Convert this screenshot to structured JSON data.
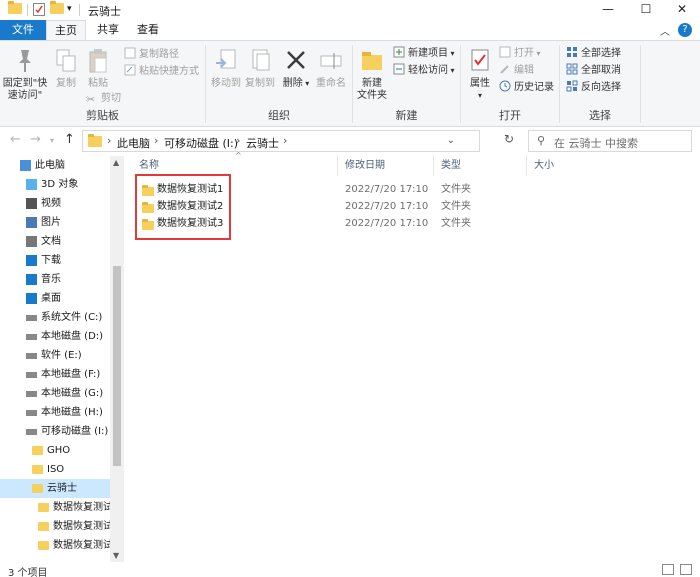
{
  "window": {
    "title": "云骑士",
    "controls": {
      "minimize": "—",
      "maximize": "☐",
      "close": "✕"
    }
  },
  "tabs": [
    {
      "label": "文件"
    },
    {
      "label": "主页"
    },
    {
      "label": "共享"
    },
    {
      "label": "查看"
    }
  ],
  "ribbon": {
    "clipboard": {
      "label": "剪贴板",
      "pin": "固定到\"快\n速访问\"",
      "copy": "复制",
      "paste": "粘贴",
      "copy_path": "复制路径",
      "paste_shortcut": "粘贴快捷方式",
      "cut": "剪切"
    },
    "organize": {
      "label": "组织",
      "move_to": "移动到",
      "copy_to": "复制到",
      "delete": "删除",
      "rename": "重命名"
    },
    "new": {
      "label": "新建",
      "new_folder": "新建\n文件夹",
      "new_item": "新建项目",
      "easy_access": "轻松访问"
    },
    "open": {
      "label": "打开",
      "properties": "属性",
      "open": "打开",
      "edit": "编辑",
      "history": "历史记录"
    },
    "select": {
      "label": "选择",
      "select_all": "全部选择",
      "select_none": "全部取消",
      "invert": "反向选择"
    }
  },
  "address": {
    "crumbs": [
      "此电脑",
      "可移动磁盘 (I:)",
      "云骑士"
    ],
    "search_placeholder": "在 云骑士 中搜索"
  },
  "nav": {
    "items": [
      {
        "label": "此电脑",
        "icon": "computer-icon",
        "indent": 0
      },
      {
        "label": "3D 对象",
        "icon": "3d-objects-icon",
        "indent": 1
      },
      {
        "label": "视频",
        "icon": "video-icon",
        "indent": 1
      },
      {
        "label": "图片",
        "icon": "pictures-icon",
        "indent": 1
      },
      {
        "label": "文档",
        "icon": "documents-icon",
        "indent": 1
      },
      {
        "label": "下载",
        "icon": "download-icon",
        "indent": 1
      },
      {
        "label": "音乐",
        "icon": "music-icon",
        "indent": 1
      },
      {
        "label": "桌面",
        "icon": "desktop-icon",
        "indent": 1
      },
      {
        "label": "系统文件 (C:)",
        "icon": "drive-icon",
        "indent": 1
      },
      {
        "label": "本地磁盘 (D:)",
        "icon": "drive-icon",
        "indent": 1
      },
      {
        "label": "软件 (E:)",
        "icon": "drive-icon",
        "indent": 1
      },
      {
        "label": "本地磁盘 (F:)",
        "icon": "drive-icon",
        "indent": 1
      },
      {
        "label": "本地磁盘 (G:)",
        "icon": "drive-icon",
        "indent": 1
      },
      {
        "label": "本地磁盘 (H:)",
        "icon": "drive-icon",
        "indent": 1
      },
      {
        "label": "可移动磁盘 (I:)",
        "icon": "removable-drive-icon",
        "indent": 1
      },
      {
        "label": "GHO",
        "icon": "folder-icon",
        "indent": 2
      },
      {
        "label": "ISO",
        "icon": "folder-icon",
        "indent": 2
      },
      {
        "label": "云骑士",
        "icon": "folder-icon",
        "indent": 2,
        "selected": true
      },
      {
        "label": "数据恢复测试",
        "icon": "folder-icon",
        "indent": 3
      },
      {
        "label": "数据恢复测试",
        "icon": "folder-icon",
        "indent": 3
      },
      {
        "label": "数据恢复测试",
        "icon": "folder-icon",
        "indent": 3
      }
    ]
  },
  "filelist": {
    "columns": {
      "name": "名称",
      "date": "修改日期",
      "type": "类型",
      "size": "大小"
    },
    "rows": [
      {
        "name": "数据恢复测试1",
        "date": "2022/7/20 17:10",
        "type": "文件夹"
      },
      {
        "name": "数据恢复测试2",
        "date": "2022/7/20 17:10",
        "type": "文件夹"
      },
      {
        "name": "数据恢复测试3",
        "date": "2022/7/20 17:10",
        "type": "文件夹"
      }
    ]
  },
  "status": {
    "count": "3 个项目"
  },
  "colors": {
    "accent": "#1979ca",
    "selection": "#cce8ff",
    "folder": "#f6cf5c",
    "highlight": "#e23a3a"
  }
}
